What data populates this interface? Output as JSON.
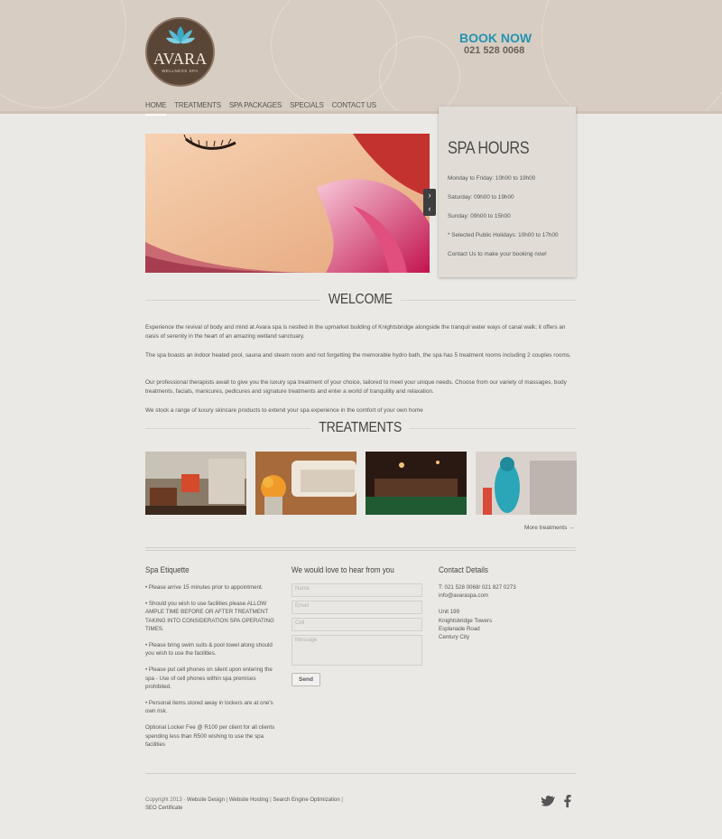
{
  "header": {
    "logo_name": "AVARA",
    "logo_sub": "WELLNESS SPA",
    "book_now": "BOOK NOW",
    "phone": "021 528 0068"
  },
  "nav": {
    "home": "HOME",
    "treatments": "TREATMENTS",
    "spa_packages": "SPA PACKAGES",
    "specials": "SPECIALS",
    "contact_us": "CONTACT US"
  },
  "hours": {
    "title": "SPA HOURS",
    "line1": "Monday to Friday: 10h00 to 19h00",
    "line2": "Saturday: 09h00 to 19h00",
    "line3": "Sunday: 09h00 to 15h00",
    "line4": "* Selected Public Holidays: 10h00 to 17h00",
    "line5": "Contact Us to make your booking now!"
  },
  "welcome": {
    "title": "WELCOME",
    "p1": "Experience the revival of body and mind at Avara spa is nestled in the upmarket building of Knightsbridge alongside the tranquil water ways of canal walk; it offers an oasis of serenity in the heart of an amazing wetland sanctuary.",
    "p2": "The spa boasts an indoor heated pool, sauna and steam room and not forgetting the memorable hydro bath, the spa has 5 treatment rooms including 2 couples rooms.",
    "p3": "Our professional therapists await to give you the luxury spa treatment of your choice, tailored to meet your unique needs. Choose from our variety of massages, body treatments, facials, manicures, pedicures and signature treatments and enter a world of tranquility and relaxation.",
    "p4": "We stock a range of luxury skincare products to extend your spa experience in the comfort of your own home"
  },
  "treatments": {
    "title": "TREATMENTS",
    "more": "More treatments →"
  },
  "etiquette": {
    "title": "Spa Etiquette",
    "items": [
      "• Please arrive 15 minutes prior to appointment.",
      "• Should you wish to use facilities please ALLOW AMPLE TIME BEFORE OR AFTER TREATMENT TAKING INTO CONSIDERATION SPA OPERATING TIMES.",
      "• Please bring swim suits & pool towel along should you wish to use the facilities.",
      "• Please put cell phones on silent upon entering the spa - Use of cell phones within spa premises prohibited.",
      "• Personal items stored away in lockers are at one's own risk.",
      "Optional Locker Fee @ R100 per client for all clients spending less than R500 wishing to use the spa facilities"
    ]
  },
  "form": {
    "title": "We would love to hear from you",
    "name_placeholder": "Name",
    "email_placeholder": "Email",
    "cell_placeholder": "Cell",
    "message_placeholder": "Message",
    "send": "Send"
  },
  "contact": {
    "title": "Contact Details",
    "phone": "T: 021 528 0068/ 021 827 0273",
    "email": "info@avaraspa.com",
    "addr1": "Unit 199",
    "addr2": "Knightsbridge Towers",
    "addr3": "Esplanade Road",
    "addr4": "Century City"
  },
  "footer": {
    "copyright": "Copyright 2013 - ",
    "link1": "Website Design",
    "sep1": " | ",
    "link2": "Website Hosting",
    "sep2": " | ",
    "link3": "Search Engine Optimization",
    "sep3": " |",
    "link4": "SEO Certificate"
  },
  "colors": {
    "accent": "#2393b2",
    "header_bg": "#d8cdc2",
    "page_bg": "#ebe9e5"
  }
}
